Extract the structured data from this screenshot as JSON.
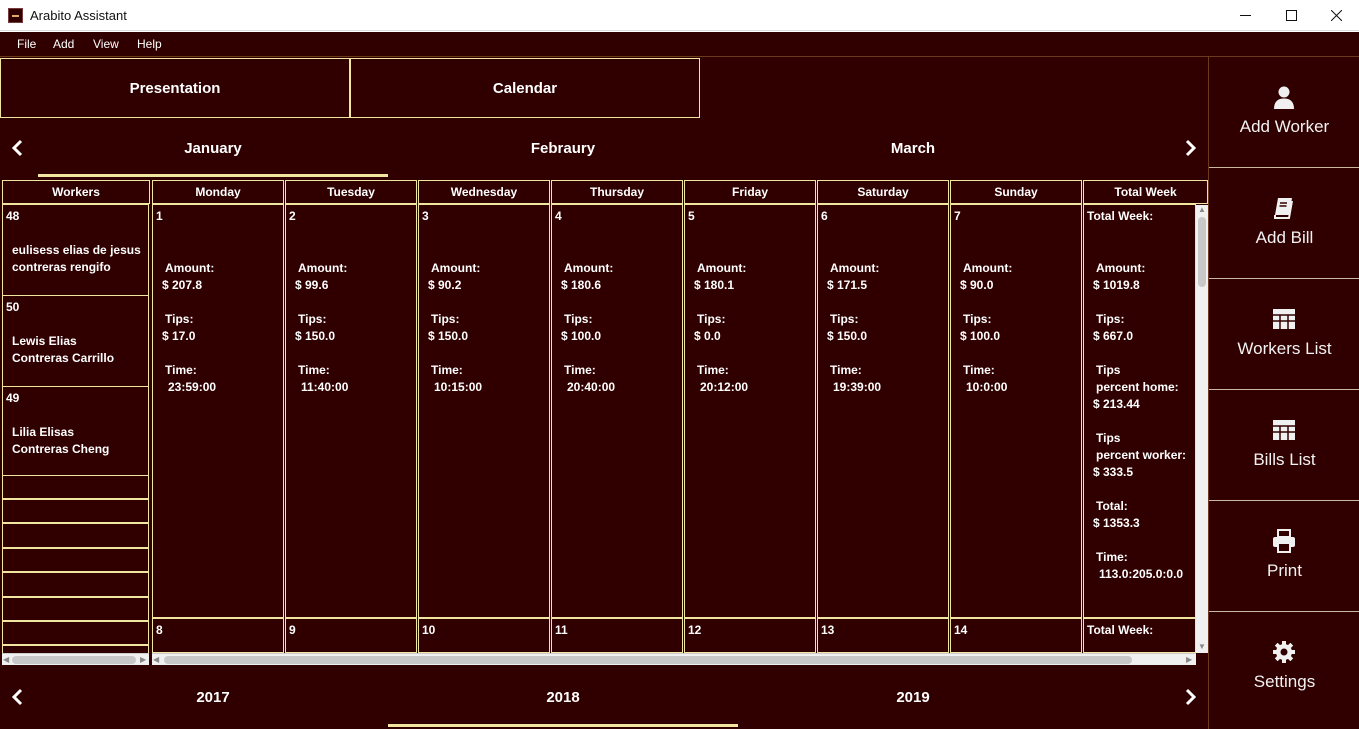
{
  "window": {
    "title": "Arabito Assistant"
  },
  "menu": [
    "File",
    "Add",
    "View",
    "Help"
  ],
  "tabs": {
    "presentation": "Presentation",
    "calendar": "Calendar"
  },
  "months": [
    "January",
    "Febraury",
    "March"
  ],
  "years": [
    "2017",
    "2018",
    "2019"
  ],
  "headers": {
    "workers": "Workers",
    "days": [
      "Monday",
      "Tuesday",
      "Wednesday",
      "Thursday",
      "Friday",
      "Saturday",
      "Sunday"
    ],
    "total": "Total Week"
  },
  "workers": [
    {
      "id": "48",
      "name1": "eulisess elias de jesus",
      "name2": "contreras rengifo"
    },
    {
      "id": "50",
      "name1": "Lewis Elias",
      "name2": "Contreras Carrillo"
    },
    {
      "id": "49",
      "name1": "Lilia Elisas",
      "name2": "Contreras Cheng"
    }
  ],
  "labels": {
    "amount": "Amount:",
    "tips": "Tips:",
    "time": "Time:",
    "total_week": "Total Week:",
    "tips_word": "Tips",
    "percent_home": "percent home:",
    "percent_worker": "percent worker:",
    "total": "Total:"
  },
  "week1": [
    {
      "day": "1",
      "amount": "$ 207.8",
      "tips": "$ 17.0",
      "time": "23:59:00"
    },
    {
      "day": "2",
      "amount": "$ 99.6",
      "tips": "$ 150.0",
      "time": "11:40:00"
    },
    {
      "day": "3",
      "amount": "$ 90.2",
      "tips": "$ 150.0",
      "time": "10:15:00"
    },
    {
      "day": "4",
      "amount": "$ 180.6",
      "tips": "$ 100.0",
      "time": "20:40:00"
    },
    {
      "day": "5",
      "amount": "$ 180.1",
      "tips": "$ 0.0",
      "time": "20:12:00"
    },
    {
      "day": "6",
      "amount": "$ 171.5",
      "tips": "$ 150.0",
      "time": "19:39:00"
    },
    {
      "day": "7",
      "amount": "$ 90.0",
      "tips": "$ 100.0",
      "time": "10:0:00"
    }
  ],
  "week1_total": {
    "amount": "$ 1019.8",
    "tips": "$ 667.0",
    "tips_home": "$ 213.44",
    "tips_worker": "$ 333.5",
    "total": "$ 1353.3",
    "time": "113.0:205.0:0.0"
  },
  "week2_days": [
    "8",
    "9",
    "10",
    "11",
    "12",
    "13",
    "14"
  ],
  "sidebar": [
    "Add Worker",
    "Add Bill",
    "Workers List",
    "Bills List",
    "Print",
    "Settings"
  ],
  "icons": {
    "worker": "person-icon",
    "bill": "book-icon",
    "workers_list": "table-icon",
    "bills_list": "table-icon",
    "print": "printer-icon",
    "settings": "gear-icon"
  },
  "colors": {
    "background": "#300000",
    "border": "#f0e6a0",
    "text": "#ffffff"
  }
}
